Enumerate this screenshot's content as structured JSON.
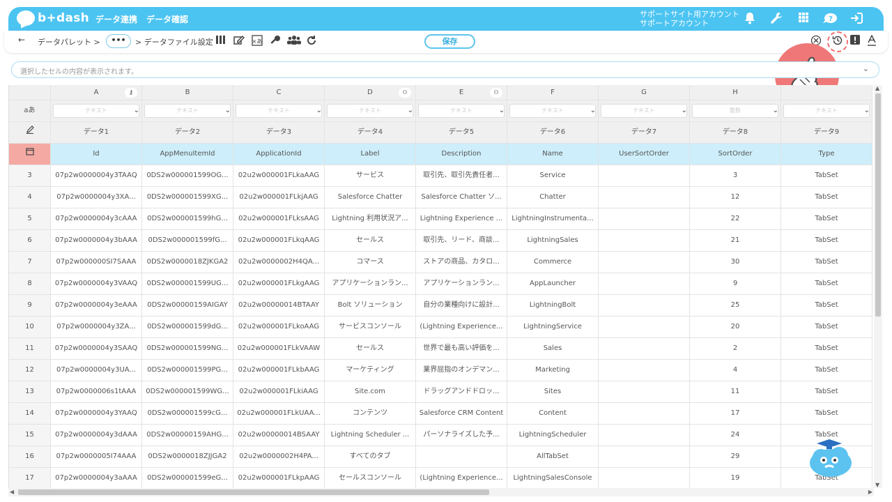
{
  "header": {
    "logo_text": "b+dash",
    "menu": [
      "データ連携",
      "データ確認"
    ],
    "account_line1": "サポートサイト用アカウント",
    "account_line2": "サポートアカウント",
    "icons": [
      "bell-icon",
      "wrench-icon",
      "apps-grid-icon",
      "help-bubble-icon",
      "logout-icon"
    ]
  },
  "toolbar": {
    "back_arrow": "←",
    "crumb1": "データパレット >",
    "dots": "•••",
    "crumb2": "> データファイル設定",
    "save_label": "保存",
    "icons_left": [
      "column-icon",
      "edit-icon",
      "formula-icon",
      "key-icon",
      "group-icon",
      "refresh-icon"
    ],
    "icons_right": [
      "clear-icon",
      "history-icon",
      "alert-icon",
      "font-icon"
    ]
  },
  "cellbar": {
    "placeholder": "選択したセルの内容が表示されます。"
  },
  "grid": {
    "type_row_label": "aあ",
    "columns": [
      {
        "letter": "A",
        "type": "テキスト",
        "label": "データ1",
        "name": "Id",
        "icon": "key"
      },
      {
        "letter": "B",
        "type": "テキスト",
        "label": "データ2",
        "name": "AppMenuItemId",
        "icon": ""
      },
      {
        "letter": "C",
        "type": "テキスト",
        "label": "データ3",
        "name": "ApplicationId",
        "icon": ""
      },
      {
        "letter": "D",
        "type": "テキスト",
        "label": "データ4",
        "name": "Label",
        "icon": "group"
      },
      {
        "letter": "E",
        "type": "テキスト",
        "label": "データ5",
        "name": "Description",
        "icon": "group"
      },
      {
        "letter": "F",
        "type": "テキスト",
        "label": "データ6",
        "name": "Name",
        "icon": ""
      },
      {
        "letter": "G",
        "type": "テキスト",
        "label": "データ7",
        "name": "UserSortOrder",
        "icon": ""
      },
      {
        "letter": "H",
        "type": "整数",
        "label": "データ8",
        "name": "SortOrder",
        "icon": ""
      },
      {
        "letter": "",
        "type": "テキスト",
        "label": "データ9",
        "name": "Type",
        "icon": ""
      }
    ],
    "rows": [
      {
        "num": "3",
        "cells": [
          "07p2w0000004y3TAAQ",
          "0DS2w000001599OG...",
          "02u2w000001FLkaAAG",
          "サービス",
          "取引先、取引先責任者...",
          "Service",
          "",
          "3",
          "TabSet"
        ]
      },
      {
        "num": "4",
        "cells": [
          "07p2w0000004y3XA...",
          "0DS2w000001599XG...",
          "02u2w000001FLkjAAG",
          "Salesforce Chatter",
          "Salesforce Chatter ソ...",
          "Chatter",
          "",
          "12",
          "TabSet"
        ]
      },
      {
        "num": "5",
        "cells": [
          "07p2w0000004y3cAAA",
          "0DS2w000001599hG...",
          "02u2w000001FLksAAG",
          "Lightning 利用状況ア...",
          "Lightning Experience ...",
          "LightningInstrumenta...",
          "",
          "22",
          "TabSet"
        ]
      },
      {
        "num": "6",
        "cells": [
          "07p2w0000004y3bAAA",
          "0DS2w000001599fG...",
          "02u2w000001FLkqAAG",
          "セールス",
          "取引先、リード、商談...",
          "LightningSales",
          "",
          "21",
          "TabSet"
        ]
      },
      {
        "num": "7",
        "cells": [
          "07p2w000000SI7SAAA",
          "0DS2w0000018ZJKGA2",
          "02u2w0000002H4QA...",
          "コマース",
          "ストアの商品、カタロ...",
          "Commerce",
          "",
          "30",
          "TabSet"
        ]
      },
      {
        "num": "8",
        "cells": [
          "07p2w0000004y3VAAQ",
          "0DS2w000001599UG...",
          "02u2w000001FLkgAAG",
          "アプリケーションラン...",
          "アプリケーションラン...",
          "AppLauncher",
          "",
          "9",
          "TabSet"
        ]
      },
      {
        "num": "9",
        "cells": [
          "07p2w0000004y3eAAA",
          "0DS2w00000159AIGAY",
          "02u2w00000014BTAAY",
          "Bolt ソリューション",
          "自分の業種向けに設計...",
          "LightningBolt",
          "",
          "25",
          "TabSet"
        ]
      },
      {
        "num": "10",
        "cells": [
          "07p2w0000004y3ZA...",
          "0DS2w000001599dG...",
          "02u2w000001FLkoAAG",
          "サービスコンソール",
          "(Lightning Experience...",
          "LightningService",
          "",
          "20",
          "TabSet"
        ]
      },
      {
        "num": "11",
        "cells": [
          "07p2w0000004y3SAAQ",
          "0DS2w000001599NG...",
          "02u2w000001FLkVAAW",
          "セールス",
          "世界で最も高い評価を...",
          "Sales",
          "",
          "2",
          "TabSet"
        ]
      },
      {
        "num": "12",
        "cells": [
          "07p2w0000004y3UA...",
          "0DS2w000001599PG...",
          "02u2w000001FLkbAAG",
          "マーケティング",
          "業界屈指のオンデマン...",
          "Marketing",
          "",
          "4",
          "TabSet"
        ]
      },
      {
        "num": "13",
        "cells": [
          "07p2w0000006s1tAAA",
          "0DS2w000001599WG...",
          "02u2w000001FLkiAAG",
          "Site.com",
          "ドラッグアンドドロッ...",
          "Sites",
          "",
          "11",
          "TabSet"
        ]
      },
      {
        "num": "14",
        "cells": [
          "07p2w0000004y3YAAQ",
          "0DS2w000001599cG...",
          "02u2w000001FLkUAA...",
          "コンテンツ",
          "Salesforce CRM Content",
          "Content",
          "",
          "17",
          "TabSet"
        ]
      },
      {
        "num": "15",
        "cells": [
          "07p2w0000004y3dAAA",
          "0DS2w00000159AHG...",
          "02u2w00000014BSAAY",
          "Lightning Scheduler ...",
          "パーソナライズした予...",
          "LightningScheduler",
          "",
          "24",
          "TabSet"
        ]
      },
      {
        "num": "16",
        "cells": [
          "07p2w0000005I74AAA",
          "0DS2w0000018ZJJGA2",
          "02u2w0000002H4PA...",
          "すべてのタブ",
          "",
          "AllTabSet",
          "",
          "29",
          "TabSet"
        ]
      },
      {
        "num": "17",
        "cells": [
          "07p2w0000004y3aAAA",
          "0DS2w000001599eG...",
          "02u2w000001FLkpAAG",
          "セールスコンソール",
          "(Lightning Experience...",
          "LightningSalesConsole",
          "",
          "19",
          "TabSet"
        ]
      }
    ]
  }
}
